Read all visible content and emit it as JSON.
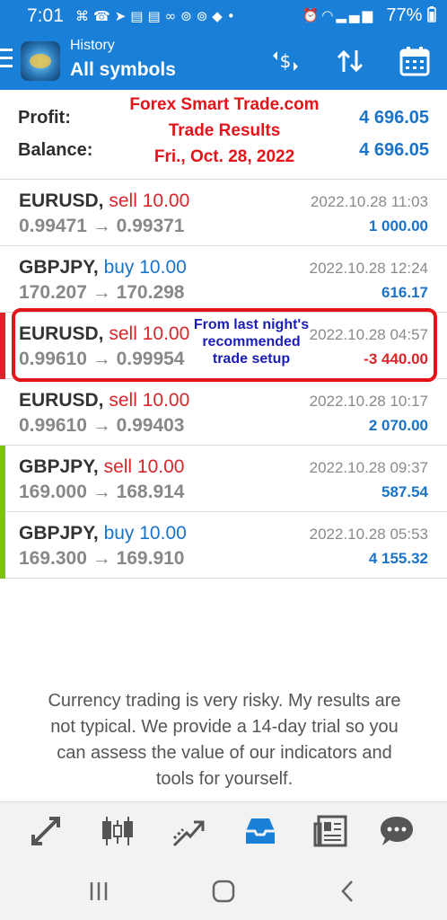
{
  "status_bar": {
    "time": "7:01",
    "battery": "77%",
    "left_icons": [
      "status-icon",
      "whatsapp-icon",
      "telegram-icon",
      "message-icon",
      "message-icon",
      "voicemail-icon",
      "toyota-icon",
      "toyota-icon",
      "app-icon"
    ],
    "right_icons": [
      "alarm-icon",
      "wifi-icon",
      "signal-icon"
    ]
  },
  "app_bar": {
    "subtitle": "History",
    "title": "All symbols",
    "actions": [
      "currency-sort-icon",
      "sort-icon",
      "calendar-icon"
    ]
  },
  "summary": {
    "profit_label": "Profit:",
    "profit_value": "4 696.05",
    "balance_label": "Balance:",
    "balance_value": "4 696.05"
  },
  "overlay": {
    "line1": "Forex Smart Trade.com",
    "line2": "Trade Results",
    "line3": "Fri., Oct. 28, 2022",
    "note_line1": "From last night's",
    "note_line2": "recommended",
    "note_line3": "trade setup"
  },
  "deals": [
    {
      "symbol": "EURUSD,",
      "type": "sell 10.00",
      "dir": "sell",
      "prices": "0.99471 → 0.99371",
      "time": "2022.10.28 11:03",
      "profit": "1 000.00",
      "sign": "pos",
      "accent": "none"
    },
    {
      "symbol": "GBPJPY,",
      "type": "buy 10.00",
      "dir": "buy",
      "prices": "170.207 → 170.298",
      "time": "2022.10.28 12:24",
      "profit": "616.17",
      "sign": "pos",
      "accent": "none"
    },
    {
      "symbol": "EURUSD,",
      "type": "sell 10.00",
      "dir": "sell",
      "prices": "0.99610 → 0.99954",
      "time": "2022.10.28 04:57",
      "profit": "-3 440.00",
      "sign": "neg",
      "accent": "red"
    },
    {
      "symbol": "EURUSD,",
      "type": "sell 10.00",
      "dir": "sell",
      "prices": "0.99610 → 0.99403",
      "time": "2022.10.28 10:17",
      "profit": "2 070.00",
      "sign": "pos",
      "accent": "none"
    },
    {
      "symbol": "GBPJPY,",
      "type": "sell 10.00",
      "dir": "sell",
      "prices": "169.000 → 168.914",
      "time": "2022.10.28 09:37",
      "profit": "587.54",
      "sign": "pos",
      "accent": "green"
    },
    {
      "symbol": "GBPJPY,",
      "type": "buy 10.00",
      "dir": "buy",
      "prices": "169.300 → 169.910",
      "time": "2022.10.28 05:53",
      "profit": "4 155.32",
      "sign": "pos",
      "accent": "green"
    }
  ],
  "disclaimer": "Currency trading is very risky. My results are not typical. We provide a 14-day trial so you can assess the value of our indicators and tools for yourself.",
  "bottom_nav": [
    "quotes-icon",
    "chart-icon",
    "trade-icon",
    "history-icon",
    "news-icon",
    "chat-icon"
  ],
  "colors": {
    "brand_blue": "#1a7fd6",
    "value_blue": "#1a73c8",
    "sell_red": "#d9262b",
    "accent_green": "#7cc21a",
    "annotation_red": "#e4141a",
    "annotation_blue": "#1b1db8"
  }
}
